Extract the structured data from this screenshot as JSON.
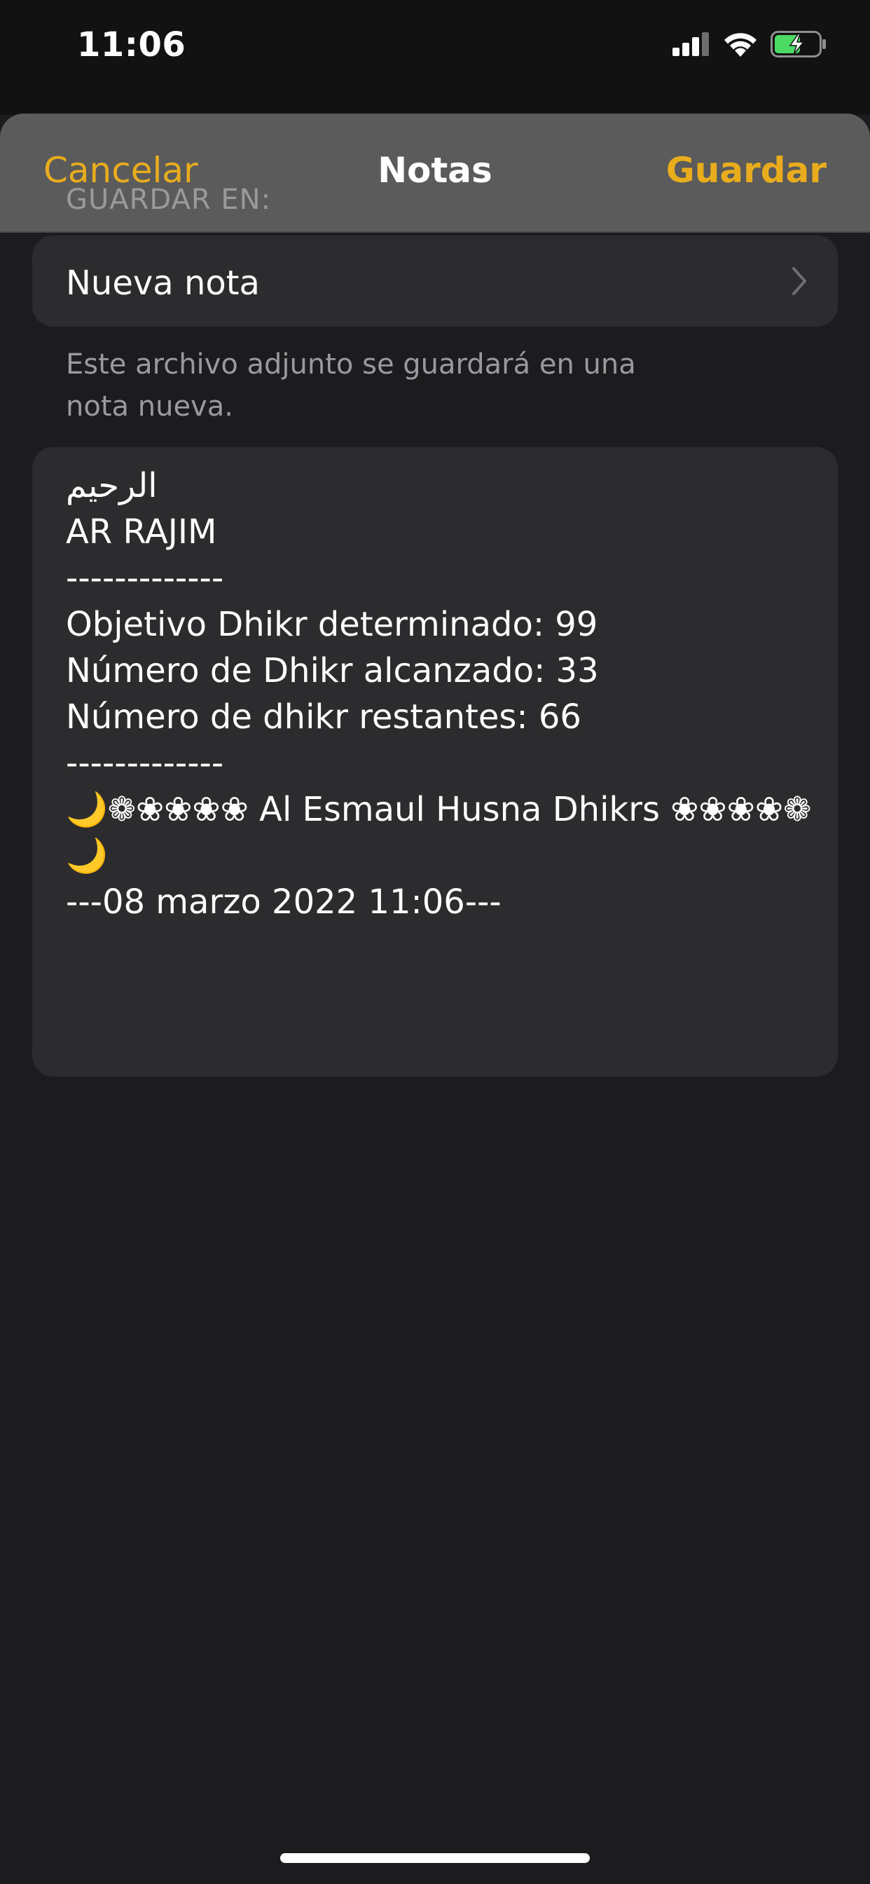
{
  "status_bar": {
    "time": "11:06",
    "icons": [
      "cellular-signal-icon",
      "wifi-icon",
      "battery-charging-icon"
    ]
  },
  "nav": {
    "cancel_label": "Cancelar",
    "title": "Notas",
    "save_label": "Guardar"
  },
  "destination": {
    "header": "GUARDAR EN:",
    "row_label": "Nueva nota",
    "footer": "Este archivo adjunto se guardará en una nota nueva."
  },
  "note": {
    "text": "الرحيم\nAR RAJIM\n-------------\nObjetivo Dhikr determinado: 99\nNúmero de Dhikr alcanzado: 33\nNúmero de dhikr restantes: 66\n-------------\n🌙❁❀❀❀❀ Al Esmaul Husna Dhikrs ❀❀❀❀❁🌙\n---08 marzo 2022 11:06---"
  },
  "colors": {
    "accent": "#e8ac1c",
    "navbar_bg": "#5b5b5b",
    "sheet_bg": "#1c1c1e",
    "cell_bg": "#2c2c2e",
    "secondary_text": "#9a9a9e",
    "battery_green": "#4cd964"
  }
}
